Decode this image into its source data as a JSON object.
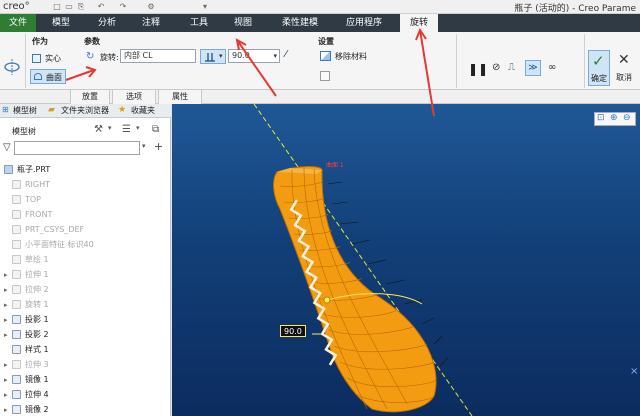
{
  "titlebar": {
    "logo": "creo°",
    "quick_access": [
      "□",
      "▭",
      "⎘",
      "↶",
      "↷",
      "⚙",
      "▾"
    ],
    "window_title": "瓶子 (活动的) - Creo Parame"
  },
  "tabs": {
    "file": "文件",
    "items": [
      "模型",
      "分析",
      "注释",
      "工具",
      "视图",
      "柔性建模",
      "应用程序"
    ],
    "active": "旋转"
  },
  "ribbon": {
    "group_as": "作为",
    "solid": "实心",
    "surface": "曲面",
    "group_params": "参数",
    "rotate_label": "旋转:",
    "axis_value": "内部 CL",
    "angle_value": "90.0",
    "group_settings": "设置",
    "remove_material": "移除材料",
    "confirm": "确定",
    "cancel": "取消",
    "subtabs": [
      "放置",
      "选项",
      "属性"
    ]
  },
  "model_tree": {
    "tabs": [
      "模型树",
      "文件夹浏览器",
      "收藏夹"
    ],
    "header": "模型树",
    "root": "瓶子.PRT",
    "items": [
      {
        "label": "RIGHT",
        "greyed": true,
        "expander": ""
      },
      {
        "label": "TOP",
        "greyed": true,
        "expander": ""
      },
      {
        "label": "FRONT",
        "greyed": true,
        "expander": ""
      },
      {
        "label": "PRT_CSYS_DEF",
        "greyed": true,
        "expander": ""
      },
      {
        "label": "小平面特征 标识40",
        "greyed": true,
        "expander": ""
      },
      {
        "label": "草绘 1",
        "greyed": true,
        "expander": ""
      },
      {
        "label": "拉伸 1",
        "greyed": true,
        "expander": "▸"
      },
      {
        "label": "拉伸 2",
        "greyed": true,
        "expander": "▸"
      },
      {
        "label": "旋转 1",
        "greyed": true,
        "expander": "▸"
      },
      {
        "label": "投影 1",
        "greyed": false,
        "expander": "▸"
      },
      {
        "label": "投影 2",
        "greyed": false,
        "expander": "▸"
      },
      {
        "label": "样式 1",
        "greyed": false,
        "expander": ""
      },
      {
        "label": "拉伸 3",
        "greyed": true,
        "expander": "▸"
      },
      {
        "label": "镜像 1",
        "greyed": false,
        "expander": "▸"
      },
      {
        "label": "拉伸 4",
        "greyed": false,
        "expander": "▸"
      },
      {
        "label": "镜像 2",
        "greyed": false,
        "expander": "▸"
      }
    ]
  },
  "viewport": {
    "angle_tag": "90.0",
    "axis_label": "曲面 1"
  },
  "colors": {
    "ribbon_tab_bg": "#2f3a45",
    "file_tab": "#2e7d32",
    "model_orange": "#f39c12",
    "accent_arrow": "#e53935",
    "viewport_bg": "#1a4c8c"
  }
}
